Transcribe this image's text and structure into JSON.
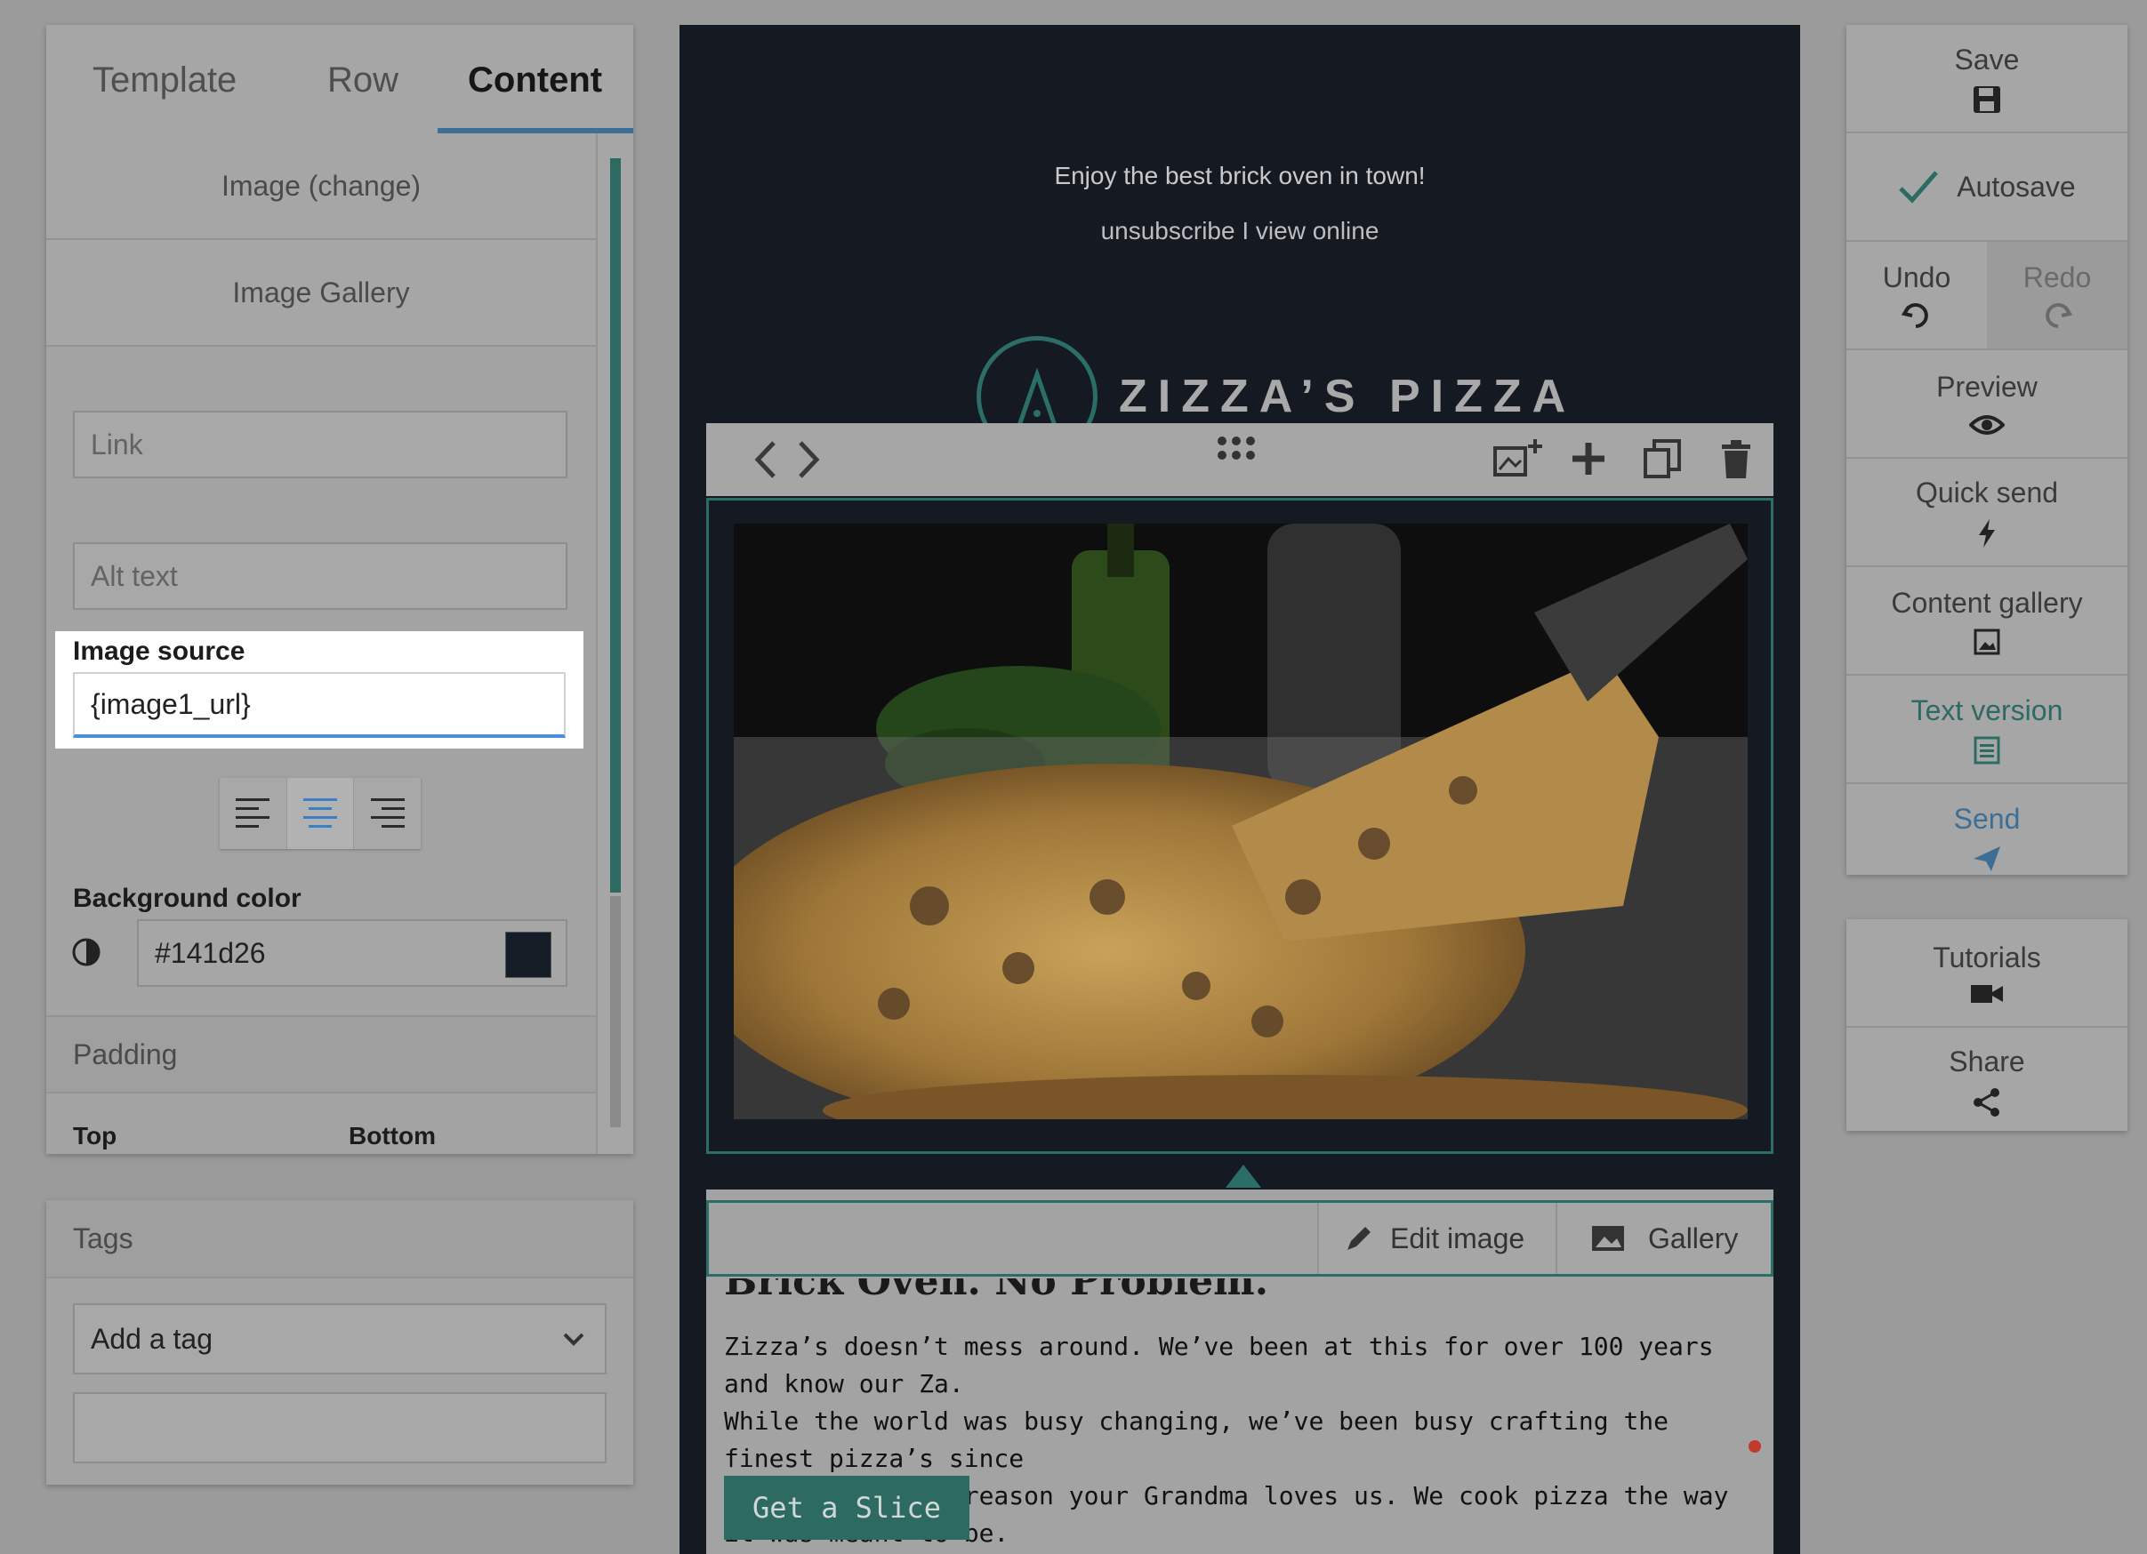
{
  "left_panel": {
    "tabs": [
      {
        "label": "Template"
      },
      {
        "label": "Row"
      },
      {
        "label": "Content"
      }
    ],
    "image_change_label": "Image (change)",
    "image_gallery_label": "Image Gallery",
    "link_placeholder": "Link",
    "alt_text_placeholder": "Alt text",
    "image_source_label": "Image source",
    "image_source_value": "{image1_url}",
    "background_color_label": "Background color",
    "background_color_value": "#141d26",
    "padding_label": "Padding",
    "top_label": "Top",
    "bottom_label": "Bottom"
  },
  "tags_panel": {
    "title": "Tags",
    "select_value": "Add a tag"
  },
  "canvas": {
    "tagline": "Enjoy the best brick oven in town!",
    "header_links": "unsubscribe  I  view online",
    "brand_name": "ZIZZA’S PIZZA",
    "headline_partial": "Brick Oven. No Problem.",
    "body_line1": "Zizza’s doesn’t mess around. We’ve been at this for over 100 years and know our Za.",
    "body_line2": "While the world was busy changing, we’ve been busy crafting the finest pizza’s since",
    "body_line3": "1892. There’s a reason your Grandma loves us. We cook pizza the way it was meant to be.",
    "cta_label": "Get a Slice",
    "edit_image_label": "Edit image",
    "gallery_label": "Gallery"
  },
  "sidebar": {
    "save": "Save",
    "autosave": "Autosave",
    "undo": "Undo",
    "redo": "Redo",
    "preview": "Preview",
    "quick_send": "Quick send",
    "content_gallery": "Content gallery",
    "text_version": "Text version",
    "send": "Send",
    "tutorials": "Tutorials",
    "share": "Share"
  },
  "colors": {
    "accent_teal": "#2d6a62",
    "accent_blue": "#3d6f96",
    "canvas_bg": "#151a22"
  }
}
